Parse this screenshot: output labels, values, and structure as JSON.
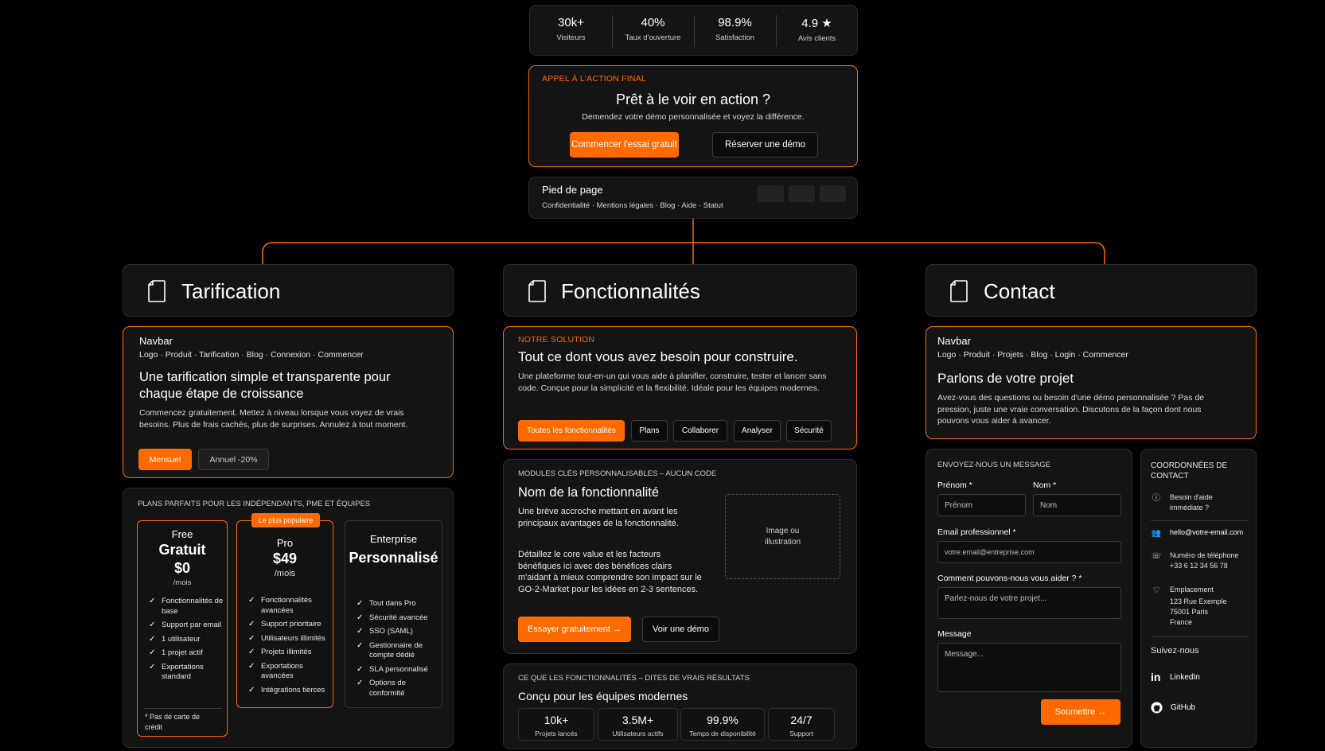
{
  "stats": [
    {
      "value": "30k+",
      "label": "Visiteurs"
    },
    {
      "value": "40%",
      "label": "Taux d'ouverture"
    },
    {
      "value": "98.9%",
      "label": "Satisfaction"
    },
    {
      "value": "4.9 ★",
      "label": "Avis clients"
    }
  ],
  "cta": {
    "kicker": "Appel à l'action final",
    "title": "Prêt à le voir en action ?",
    "subtitle": "Demendez votre démo personnalisée et voyez la différence.",
    "primary": "Commencer l'essai gratuit",
    "secondary": "Réserver une démo"
  },
  "footer": {
    "label": "Pied de page",
    "links": "Confidentialité · Mentions légales · Blog · Aide · Statut"
  },
  "pages": {
    "pricing": "Tarification",
    "features": "Fonctionnalités",
    "contact": "Contact"
  },
  "pricing_hero": {
    "navbar_label": "Navbar",
    "navbar_links": "Logo · Produit · Tarification · Blog · Connexion · Commencer",
    "title": "Une tarification simple et transparente pour chaque étape de croissance",
    "body": "Commencez gratuitement. Mettez à niveau lorsque vous voyez de vrais besoins. Plus de frais cachés, plus de surprises. Annulez à tout moment.",
    "toggle_monthly": "Mensuel",
    "toggle_annual": "Annuel -20%"
  },
  "plans_section": {
    "kicker": "Plans parfaits pour les indépendants, PME et équipes",
    "plans": [
      {
        "name": "Free",
        "tier": "Gratuit",
        "price": "$0",
        "period": "/mois",
        "features": [
          "Fonctionnalités de base",
          "Support par email",
          "1 utilisateur",
          "1 projet actif",
          "Exportations standard"
        ],
        "note": "* Pas de carte de crédit"
      },
      {
        "badge": "Le plus populaire",
        "name": "Pro",
        "price": "$49",
        "period": "/mois",
        "features": [
          "Fonctionnalités avancées",
          "Support prioritaire",
          "Utilisateurs illimités",
          "Projets illimités",
          "Exportations avancées",
          "Intégrations tierces"
        ]
      },
      {
        "name": "Enterprise",
        "tier": "Personnalisé",
        "features": [
          "Tout dans Pro",
          "Sécurité avancée",
          "SSO (SAML)",
          "Gestionnaire de compte dédié",
          "SLA personnalisé",
          "Options de conformité"
        ]
      }
    ]
  },
  "features_hero": {
    "kicker": "Notre solution",
    "title": "Tout ce dont vous avez besoin pour construire.",
    "body": "Une plateforme tout-en-un qui vous aide à planifier, construire, tester et lancer sans code. Conçue pour la simplicité et la flexibilité. Idéale pour les équipes modernes.",
    "tabs": [
      "Toutes les fonctionnalités",
      "Plans",
      "Collaborer",
      "Analyser",
      "Sécurité"
    ]
  },
  "feature_module": {
    "kicker": "Modules clés personnalisables – aucun code",
    "title": "Nom de la fonctionnalité",
    "p1": "Une brève accroche mettant en avant les principaux avantages de la fonctionnalité.",
    "p2": "Détaillez le core value et les facteurs bénéfiques ici avec des bénéfices clairs m'aidant à mieux comprendre son impact sur le GO-2-Market pour les idées en 2-3 sentences.",
    "image_placeholder": "Image ou illustration",
    "primary": "Essayer gratuitement →",
    "secondary": "Voir une démo"
  },
  "results": {
    "kicker": "Ce que les fonctionnalités – dites de vrais résultats",
    "title": "Conçu pour les équipes modernes",
    "stats": [
      {
        "value": "10k+",
        "label": "Projets lancés"
      },
      {
        "value": "3.5M+",
        "label": "Utilisateurs actifs"
      },
      {
        "value": "99.9%",
        "label": "Temps de disponibilité"
      },
      {
        "value": "24/7",
        "label": "Support"
      }
    ]
  },
  "contact_hero": {
    "navbar_label": "Navbar",
    "navbar_links": "Logo · Produit · Projets · Blog · Login · Commencer",
    "title": "Parlons de votre projet",
    "body": "Avez-vous des questions ou besoin d'une démo personnalisée ? Pas de pression, juste une vraie conversation. Discutons de la façon dont nous pouvons vous aider à avancer."
  },
  "contact_form": {
    "kicker": "Envoyez-nous un message",
    "first_label": "Prénom *",
    "first_ph": "Prénom",
    "last_label": "Nom *",
    "last_ph": "Nom",
    "email_label": "Email professionnel *",
    "email_ph": "votre.email@entreprise.com",
    "help_label": "Comment pouvons-nous vous aider ? *",
    "help_ph": "Parlez-nous de votre projet...",
    "msg_label": "Message",
    "msg_ph": "Message...",
    "submit": "Soumettre →"
  },
  "contact_info": {
    "title": "Coordonnées de contact",
    "help": "Besoin d'aide immédiate ?",
    "email": "hello@votre-email.com",
    "phone_label": "Numéro de téléphone",
    "phone": "+33 6 12 34 56 78",
    "loc_label": "Emplacement",
    "loc_1": "123 Rue Exemple",
    "loc_2": "75001 Paris",
    "loc_3": "France",
    "follow": "Suivez-nous",
    "linkedin": "LinkedIn",
    "github": "GitHub"
  },
  "colors": {
    "accent": "#ff6a00",
    "card": "#141414",
    "border": "#2c2c2c",
    "background": "#000000"
  }
}
